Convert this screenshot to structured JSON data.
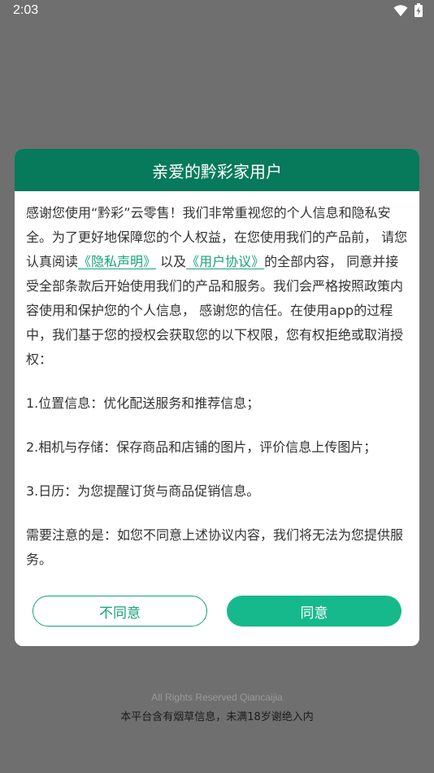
{
  "status_bar": {
    "time": "2:03",
    "icons": [
      "wifi-icon",
      "battery-charging-icon"
    ]
  },
  "dialog": {
    "title": "亲爱的黔彩家用户",
    "intro_part1": "感谢您使用“黔彩”云零售！我们非常重视您的个人信息和隐私安全。为了更好地保障您的个人权益，在您使用我们的产品前， 请您认真阅读",
    "privacy_link": "《隐私声明》",
    "intro_and": " 以及",
    "agreement_link": "《用户协议》",
    "intro_part2": "的全部内容， 同意并接受全部条款后开始使用我们的产品和服务。我们会严格按照政策内容使用和保护您的个人信息， 感谢您的信任。在使用app的过程中，我们基于您的授权会获取您的以下权限，您有权拒绝或取消授权：",
    "permissions": [
      "1.位置信息：优化配送服务和推荐信息；",
      "2.相机与存储：保存商品和店铺的图片，评价信息上传图片；",
      "3.日历：为您提醒订货与商品促销信息。"
    ],
    "notice": "需要注意的是：如您不同意上述协议内容，我们将无法为您提供服务。",
    "disagree_label": "不同意",
    "agree_label": "同意"
  },
  "footer": {
    "copyright": "All Rights Reserved Qiancaijia",
    "warning": "本平台含有烟草信息，未满18岁谢绝入内"
  },
  "colors": {
    "header_green": "#087a5c",
    "accent_green": "#16b98b",
    "link_green": "#16a27a",
    "overlay": "#6f6f6f"
  }
}
